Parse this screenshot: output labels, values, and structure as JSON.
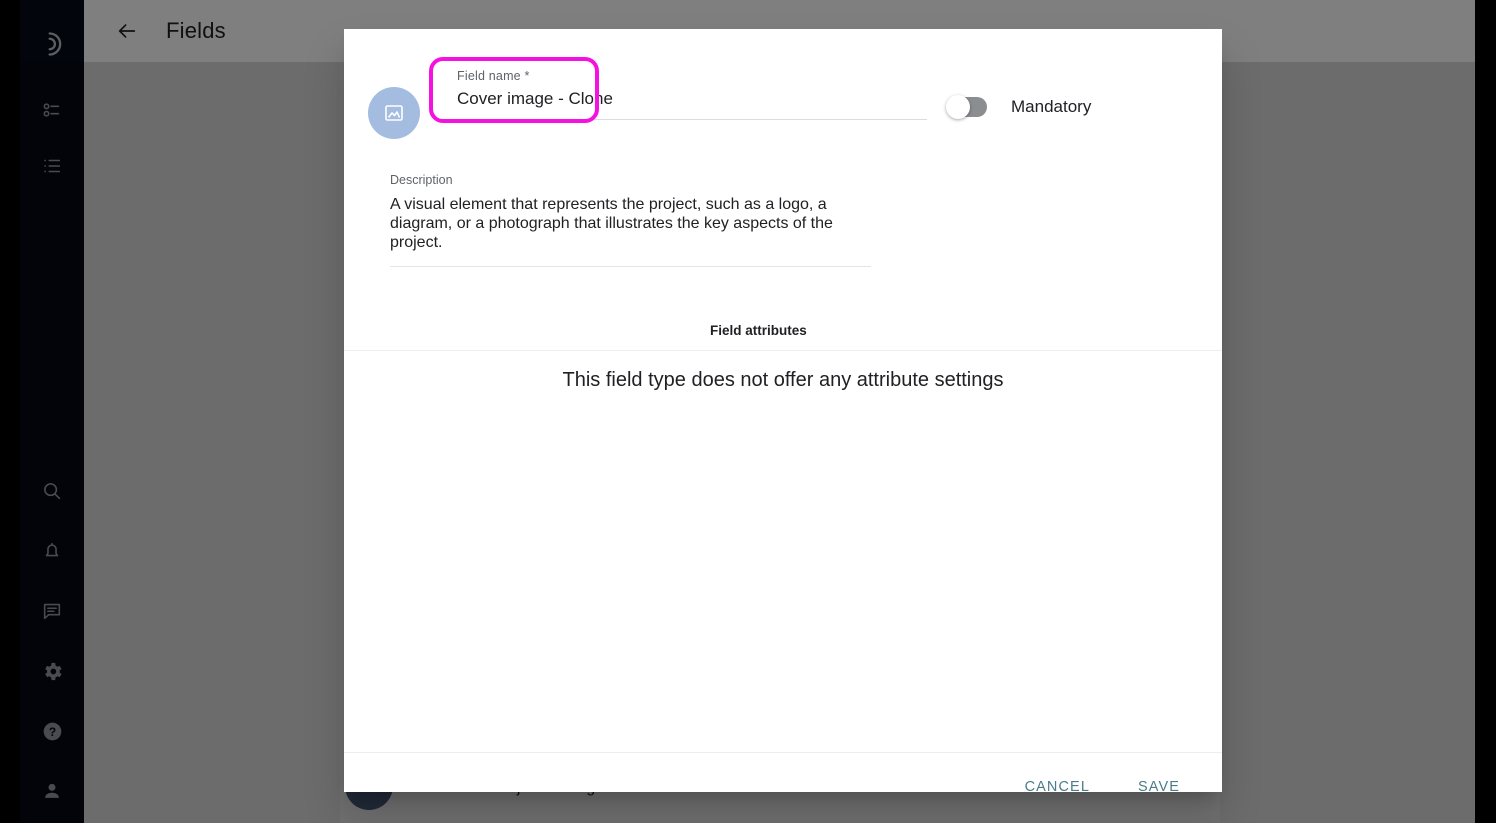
{
  "window": {
    "page_title": "Fields",
    "back_icon": "arrow-left-icon"
  },
  "sidebar": {
    "top_items": [
      {
        "name": "app-logo",
        "icon": "crescent-logo-icon"
      },
      {
        "name": "object-types",
        "icon": "radio-list-icon"
      },
      {
        "name": "lists",
        "icon": "list-icon"
      }
    ],
    "bottom_items": [
      {
        "name": "search",
        "icon": "search-icon"
      },
      {
        "name": "notifications",
        "icon": "bell-icon"
      },
      {
        "name": "messages",
        "icon": "chat-icon"
      },
      {
        "name": "settings",
        "icon": "gear-icon"
      },
      {
        "name": "help",
        "icon": "help-circle-icon"
      },
      {
        "name": "account",
        "icon": "person-icon"
      }
    ]
  },
  "background": {
    "row_label": "Project manager"
  },
  "dialog": {
    "type_icon": "image-icon",
    "field_name": {
      "label": "Field name *",
      "value": "Cover image - Clone",
      "placeholder": "Field name"
    },
    "mandatory": {
      "label": "Mandatory",
      "checked": false
    },
    "description": {
      "label": "Description",
      "value": "A visual element that represents the project, such as a logo, a diagram, or a photograph that illustrates the key aspects of the project.",
      "placeholder": "Description"
    },
    "attributes_section": {
      "title": "Field attributes",
      "empty_message": "This field type does not offer any attribute settings"
    },
    "footer": {
      "cancel_label": "CANCEL",
      "save_label": "SAVE"
    }
  },
  "annotation": {
    "color": "#F512E0",
    "target": "field-name-input"
  },
  "colors": {
    "accent_button": "#4a7c8c",
    "avatar_bg": "#A3BCE0",
    "sidebar_bg": "#060B18",
    "highlight": "#F512E0"
  }
}
